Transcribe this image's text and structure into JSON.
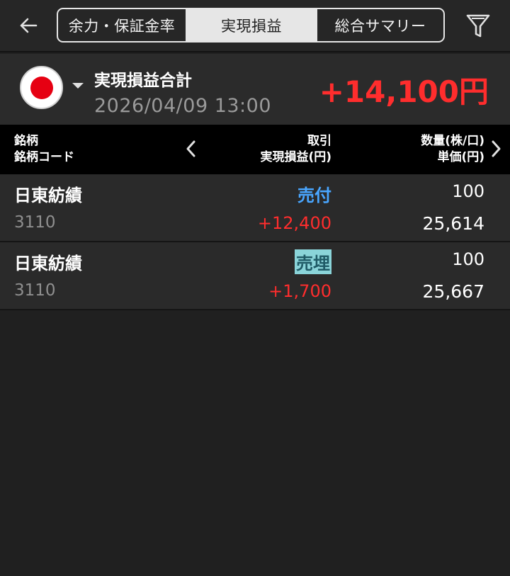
{
  "header": {
    "back_icon": "back-arrow-icon",
    "tabs": [
      {
        "label": "余力・保証金率",
        "active": false
      },
      {
        "label": "実現損益",
        "active": true
      },
      {
        "label": "総合サマリー",
        "active": false
      }
    ],
    "filter_icon": "filter-icon"
  },
  "summary": {
    "market_icon": "japan-flag-icon",
    "title": "実現損益合計",
    "datetime": "2026/04/09  13:00",
    "total": "+14,100円",
    "total_color": "#ff2d2d"
  },
  "columns": {
    "left": [
      "銘柄",
      "銘柄コード"
    ],
    "middle": [
      "取引",
      "実現損益(円)"
    ],
    "right": [
      "数量(株/口)",
      "単価(円)"
    ]
  },
  "rows": [
    {
      "name": "日東紡績",
      "code": "3110",
      "type": "売付",
      "pl": "+12,400",
      "qty": "100",
      "price": "25,614",
      "highlighted": false
    },
    {
      "name": "日東紡績",
      "code": "3110",
      "type": "売埋",
      "pl": "+1,700",
      "qty": "100",
      "price": "25,667",
      "highlighted": true
    }
  ],
  "colors": {
    "background": "#202020",
    "profit": "#ff2d2d",
    "trade_type": "#49a6ff",
    "highlight": "#8ad4d9"
  }
}
